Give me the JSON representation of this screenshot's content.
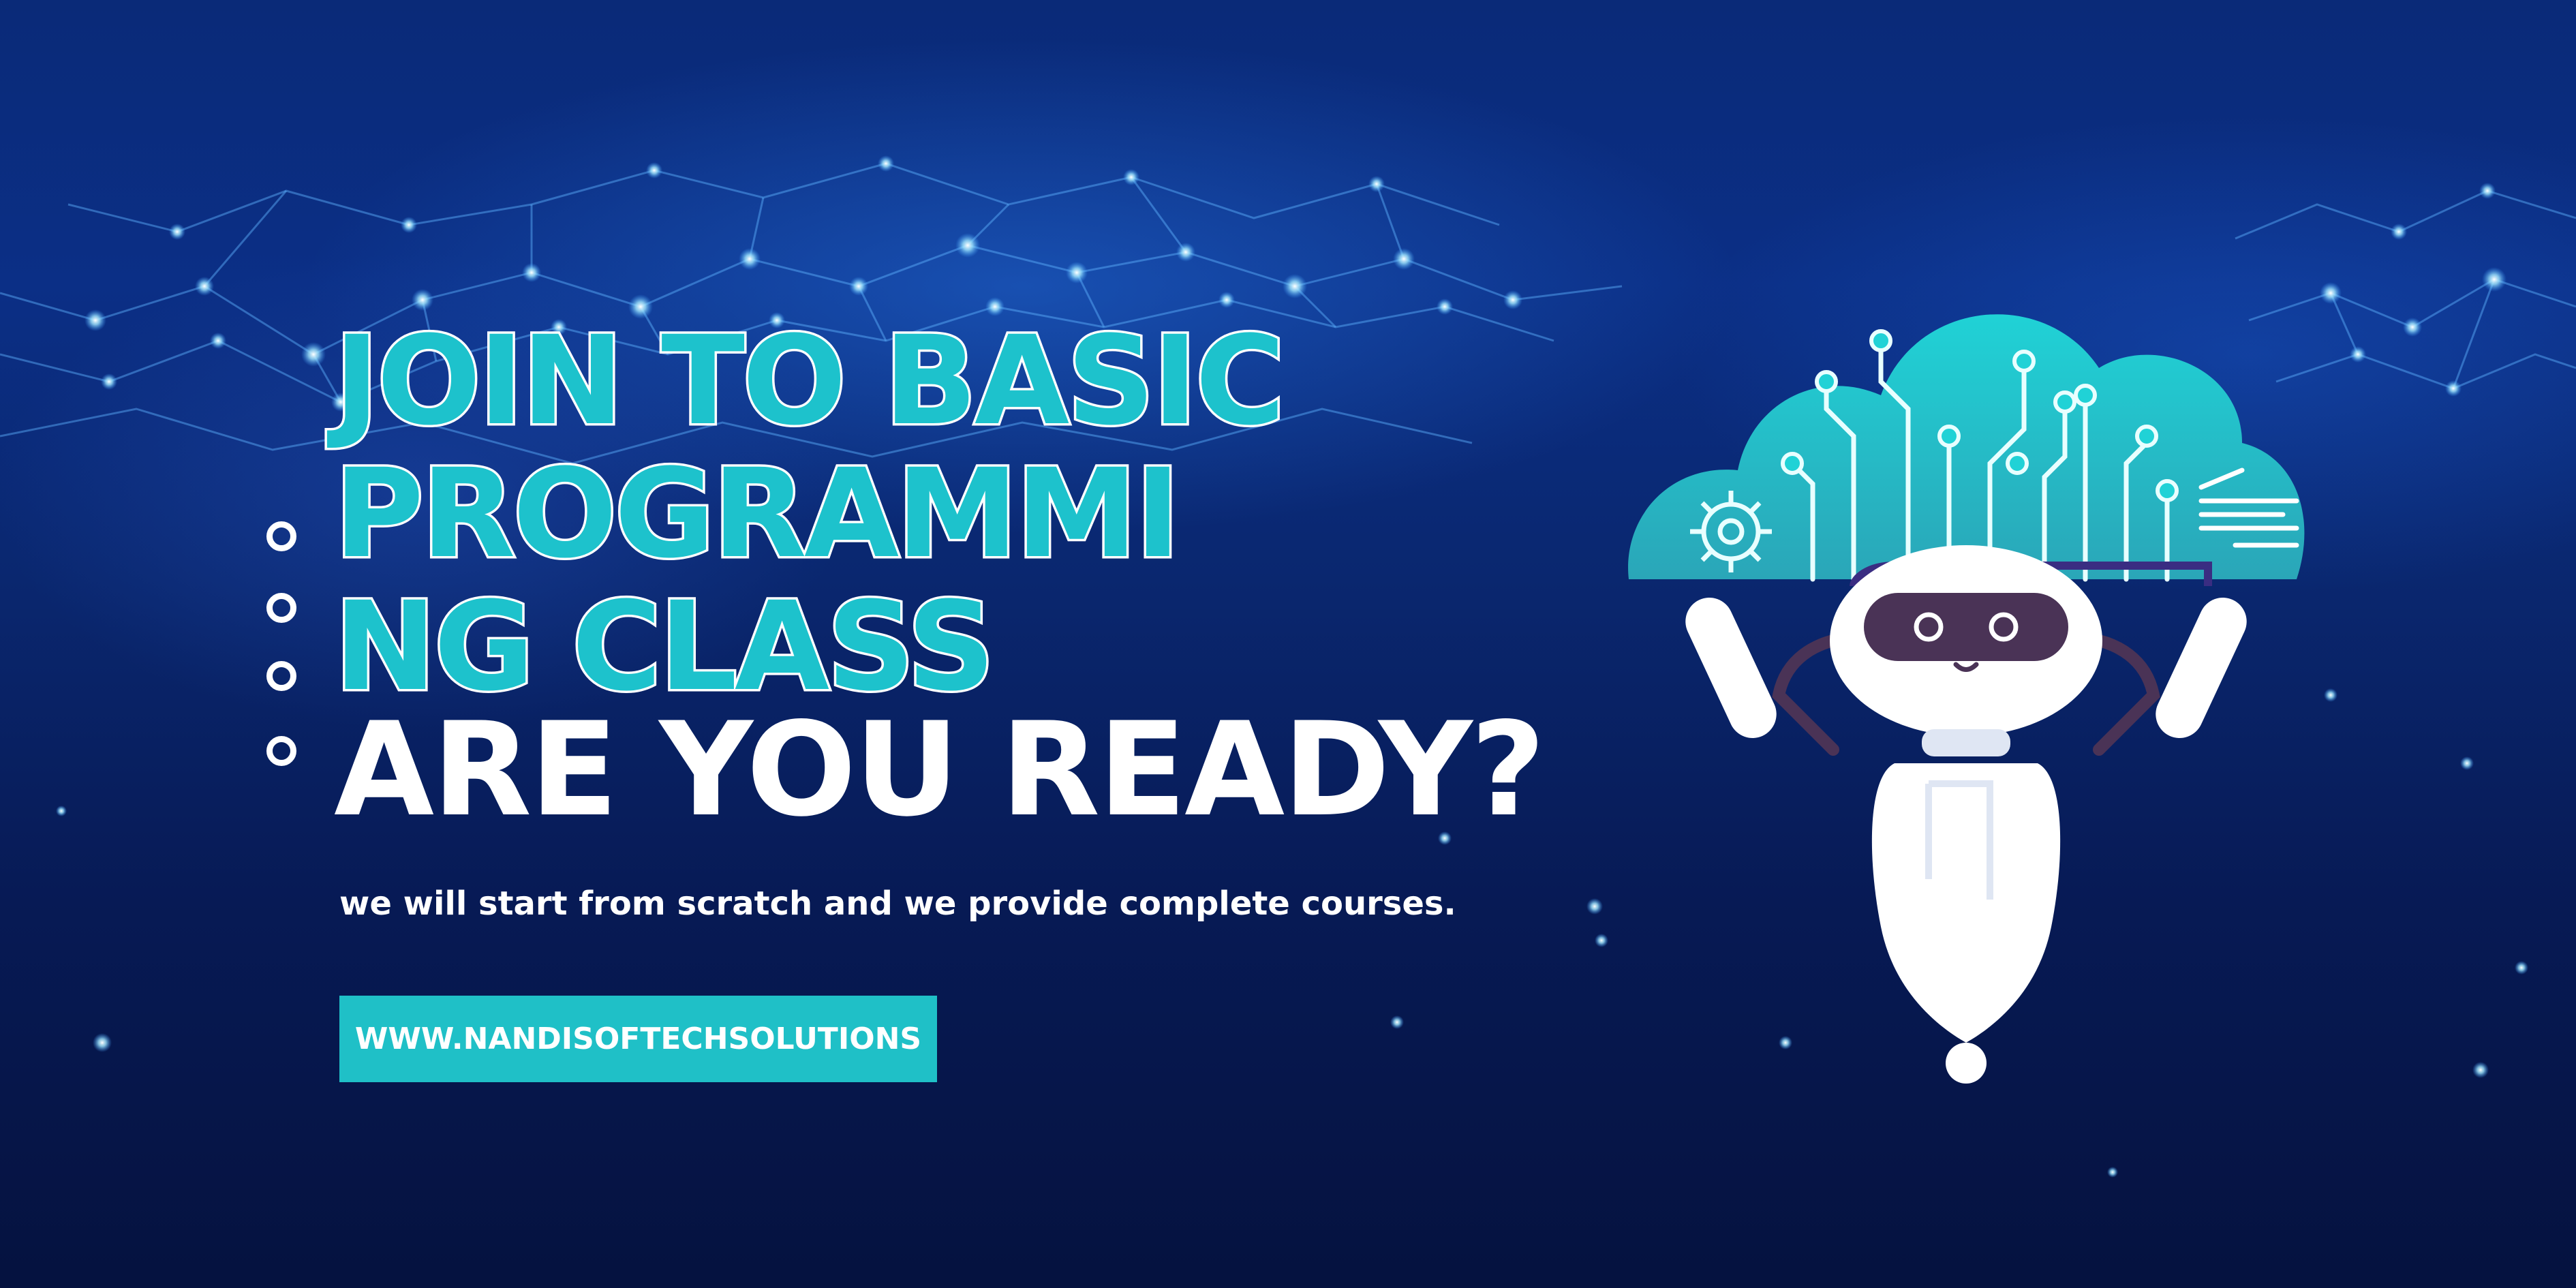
{
  "headline": {
    "line1": "JOIN TO BASIC",
    "line2": "PROGRAMMI",
    "line3": "NG CLASS"
  },
  "subheadline": "ARE YOU READY?",
  "tagline": "we will start from scratch and we provide complete courses.",
  "cta": {
    "label": "WWW.NANDISOFTECHSOLUTIONS"
  },
  "colors": {
    "background": "#071a5a",
    "accent_teal": "#1dc2cc",
    "text_white": "#ffffff",
    "robot_visor": "#4a3356"
  },
  "icons": [
    "circle-bullet-icon",
    "cloud-icon",
    "gear-icon",
    "robot-icon",
    "network-background"
  ]
}
